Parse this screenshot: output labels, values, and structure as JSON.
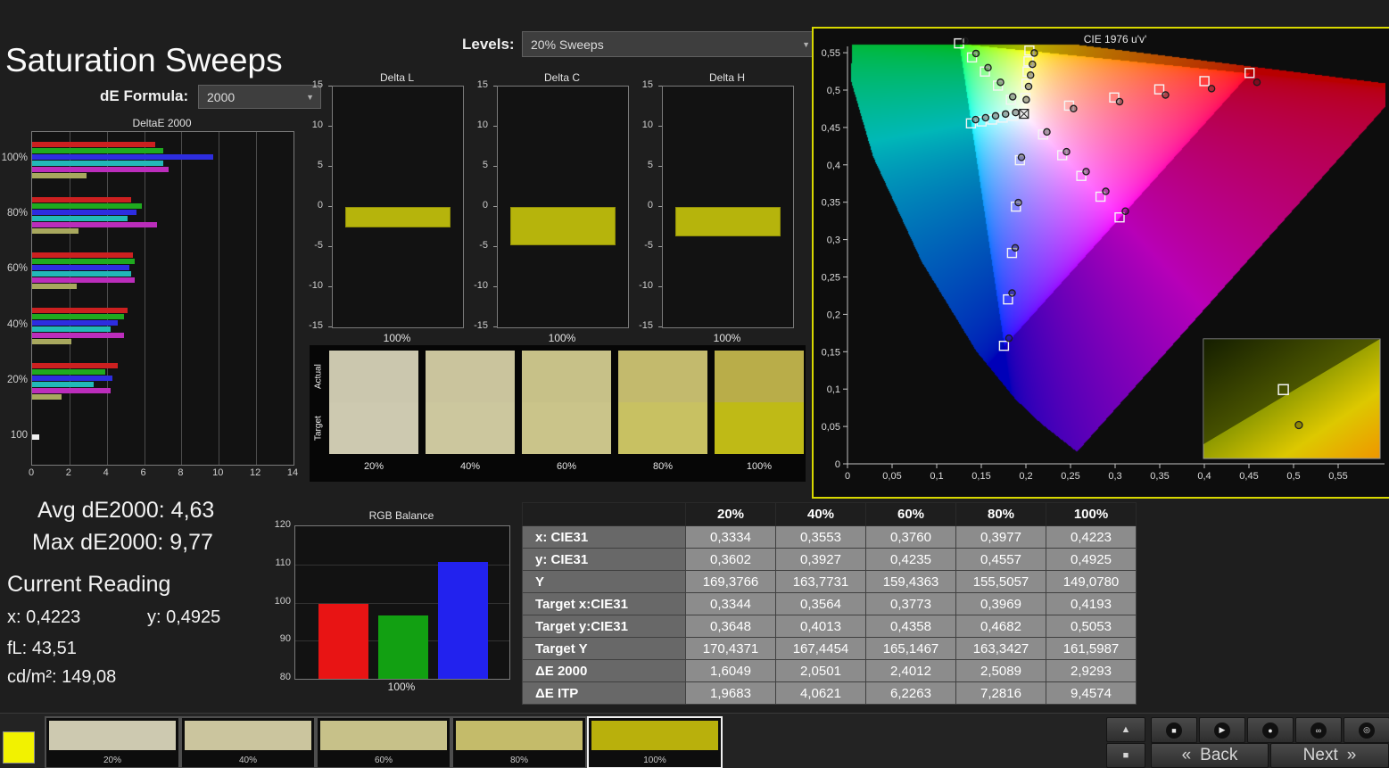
{
  "page": {
    "title": "Saturation Sweeps"
  },
  "controls": {
    "de_formula": {
      "label": "dE Formula:",
      "value": "2000"
    },
    "levels": {
      "label": "Levels:",
      "value": "20% Sweeps"
    }
  },
  "stats": {
    "avg": {
      "label": "Avg dE2000:",
      "value": "4,63"
    },
    "max": {
      "label": "Max dE2000:",
      "value": "9,77"
    },
    "current_reading": "Current Reading",
    "x": {
      "label": "x:",
      "value": "0,4223"
    },
    "y": {
      "label": "y:",
      "value": "0,4925"
    },
    "fl": {
      "label": "fL:",
      "value": "43,51"
    },
    "cdm2": {
      "label": "cd/m²:",
      "value": "149,08"
    }
  },
  "swatch_panel": {
    "row_labels": [
      "Actual",
      "Target"
    ],
    "columns": [
      {
        "label": "20%",
        "actual": "#cbc7ae",
        "target": "#cdc9b0"
      },
      {
        "label": "40%",
        "actual": "#cac49d",
        "target": "#ccc79e"
      },
      {
        "label": "60%",
        "actual": "#c7c188",
        "target": "#cac48a"
      },
      {
        "label": "80%",
        "actual": "#c3ba6d",
        "target": "#c8c162"
      },
      {
        "label": "100%",
        "actual": "#b9ad49",
        "target": "#bfba16"
      }
    ]
  },
  "table": {
    "headers": [
      "",
      "20%",
      "40%",
      "60%",
      "80%",
      "100%"
    ],
    "rows": [
      {
        "label": "x: CIE31",
        "values": [
          "0,3334",
          "0,3553",
          "0,3760",
          "0,3977",
          "0,4223"
        ]
      },
      {
        "label": "y: CIE31",
        "values": [
          "0,3602",
          "0,3927",
          "0,4235",
          "0,4557",
          "0,4925"
        ]
      },
      {
        "label": "Y",
        "values": [
          "169,3766",
          "163,7731",
          "159,4363",
          "155,5057",
          "149,0780"
        ]
      },
      {
        "label": "Target x:CIE31",
        "values": [
          "0,3344",
          "0,3564",
          "0,3773",
          "0,3969",
          "0,4193"
        ]
      },
      {
        "label": "Target y:CIE31",
        "values": [
          "0,3648",
          "0,4013",
          "0,4358",
          "0,4682",
          "0,5053"
        ]
      },
      {
        "label": "Target Y",
        "values": [
          "170,4371",
          "167,4454",
          "165,1467",
          "163,3427",
          "161,5987"
        ]
      },
      {
        "label": "ΔE 2000",
        "values": [
          "1,6049",
          "2,0501",
          "2,4012",
          "2,5089",
          "2,9293"
        ]
      },
      {
        "label": "ΔE ITP",
        "values": [
          "1,9683",
          "4,0621",
          "6,2263",
          "7,2816",
          "9,4574"
        ]
      }
    ]
  },
  "bottom_bar": {
    "patch_color": "#f2f200",
    "thumbnails": [
      {
        "label": "20%",
        "color": "#cdc9b0",
        "selected": false
      },
      {
        "label": "40%",
        "color": "#cbc59e",
        "selected": false
      },
      {
        "label": "60%",
        "color": "#c7c189",
        "selected": false
      },
      {
        "label": "80%",
        "color": "#c4bb6a",
        "selected": false
      },
      {
        "label": "100%",
        "color": "#b9b00c",
        "selected": true
      }
    ],
    "side_buttons": [
      {
        "name": "collapse",
        "glyph": "▲"
      },
      {
        "name": "stop-large",
        "glyph": "■"
      }
    ],
    "transport": [
      {
        "name": "stop",
        "glyph": "■"
      },
      {
        "name": "play",
        "glyph": "▶"
      },
      {
        "name": "record",
        "glyph": "●"
      },
      {
        "name": "loop",
        "glyph": "∞"
      },
      {
        "name": "standby",
        "glyph": "◎"
      }
    ],
    "nav": {
      "back_icon": "«",
      "back_label": "Back",
      "next_label": "Next",
      "next_icon": "»"
    }
  },
  "chart_data": {
    "deltae2000": {
      "type": "bar",
      "orientation": "horizontal",
      "title": "DeltaE 2000",
      "xlim": [
        0,
        14
      ],
      "xticks": [
        0,
        2,
        4,
        6,
        8,
        10,
        12,
        14
      ],
      "series_colors": [
        "#cc2020",
        "#1faa1f",
        "#2d2de0",
        "#22b8b8",
        "#bb2dbb",
        "#a8a85e"
      ],
      "groups": [
        {
          "label": "100%",
          "values": [
            6.6,
            7.0,
            9.7,
            7.0,
            7.3,
            2.9
          ]
        },
        {
          "label": "80%",
          "values": [
            5.3,
            5.9,
            5.6,
            5.1,
            6.7,
            2.5
          ]
        },
        {
          "label": "60%",
          "values": [
            5.4,
            5.5,
            5.2,
            5.3,
            5.5,
            2.4
          ]
        },
        {
          "label": "40%",
          "values": [
            5.1,
            4.9,
            4.6,
            4.2,
            4.9,
            2.1
          ]
        },
        {
          "label": "20%",
          "values": [
            4.6,
            3.9,
            4.3,
            3.3,
            4.2,
            1.6
          ]
        },
        {
          "label": "100",
          "values": [
            0.4
          ],
          "colors": [
            "#f0f0f0"
          ]
        }
      ]
    },
    "delta_l": {
      "type": "bar",
      "title": "Delta L",
      "ylim": [
        -15,
        15
      ],
      "yticks": [
        15,
        10,
        5,
        0,
        -5,
        -10,
        -15
      ],
      "xlabel": "100%",
      "value": -2.3,
      "color": "#b6b40c"
    },
    "delta_c": {
      "type": "bar",
      "title": "Delta C",
      "ylim": [
        -15,
        15
      ],
      "yticks": [
        15,
        10,
        5,
        0,
        -5,
        -10,
        -15
      ],
      "xlabel": "100%",
      "value": -4.6,
      "color": "#b6b40c"
    },
    "delta_h": {
      "type": "bar",
      "title": "Delta H",
      "ylim": [
        -15,
        15
      ],
      "yticks": [
        15,
        10,
        5,
        0,
        -5,
        -10,
        -15
      ],
      "xlabel": "100%",
      "value": -3.4,
      "color": "#b6b40c"
    },
    "rgb_balance": {
      "type": "bar",
      "title": "RGB Balance",
      "ylim": [
        80,
        120
      ],
      "yticks": [
        120,
        110,
        100,
        90,
        80
      ],
      "xlabel": "100%",
      "series": [
        {
          "name": "red",
          "color": "#e81414",
          "value": 99.6
        },
        {
          "name": "green",
          "color": "#12a012",
          "value": 96.6
        },
        {
          "name": "blue",
          "color": "#2222ee",
          "value": 110.6
        }
      ]
    },
    "cie": {
      "type": "scatter",
      "title": "CIE 1976 u'v'",
      "xticks": [
        {
          "v": 0,
          "label": "0"
        },
        {
          "v": 0.05,
          "label": "0,05"
        },
        {
          "v": 0.1,
          "label": "0,1"
        },
        {
          "v": 0.15,
          "label": "0,15"
        },
        {
          "v": 0.2,
          "label": "0,2"
        },
        {
          "v": 0.25,
          "label": "0,25"
        },
        {
          "v": 0.3,
          "label": "0,3"
        },
        {
          "v": 0.35,
          "label": "0,35"
        },
        {
          "v": 0.4,
          "label": "0,4"
        },
        {
          "v": 0.45,
          "label": "0,45"
        },
        {
          "v": 0.5,
          "label": "0,5"
        },
        {
          "v": 0.55,
          "label": "0,55"
        }
      ],
      "yticks": [
        {
          "v": 0,
          "label": "0"
        },
        {
          "v": 0.05,
          "label": "0,05"
        },
        {
          "v": 0.1,
          "label": "0,1"
        },
        {
          "v": 0.15,
          "label": "0,15"
        },
        {
          "v": 0.2,
          "label": "0,2"
        },
        {
          "v": 0.25,
          "label": "0,25"
        },
        {
          "v": 0.3,
          "label": "0,3"
        },
        {
          "v": 0.35,
          "label": "0,35"
        },
        {
          "v": 0.4,
          "label": "0,4"
        },
        {
          "v": 0.45,
          "label": "0,45"
        },
        {
          "v": 0.5,
          "label": "0,5"
        },
        {
          "v": 0.55,
          "label": "0,55"
        }
      ],
      "white_point": [
        0.1978,
        0.4683
      ],
      "targets": [
        [
          0.2484,
          0.4792
        ],
        [
          0.299,
          0.4901
        ],
        [
          0.3495,
          0.501
        ],
        [
          0.4001,
          0.512
        ],
        [
          0.4507,
          0.5229
        ],
        [
          0.1832,
          0.4871
        ],
        [
          0.1687,
          0.506
        ],
        [
          0.1541,
          0.5248
        ],
        [
          0.1396,
          0.5437
        ],
        [
          0.125,
          0.5625
        ],
        [
          0.1933,
          0.4062
        ],
        [
          0.1888,
          0.3441
        ],
        [
          0.1844,
          0.2821
        ],
        [
          0.1799,
          0.22
        ],
        [
          0.1754,
          0.1579
        ],
        [
          0.1859,
          0.4657
        ],
        [
          0.174,
          0.4632
        ],
        [
          0.1622,
          0.4606
        ],
        [
          0.1503,
          0.4581
        ],
        [
          0.1384,
          0.4555
        ],
        [
          0.2192,
          0.4406
        ],
        [
          0.2407,
          0.4129
        ],
        [
          0.2621,
          0.3852
        ],
        [
          0.2836,
          0.3574
        ],
        [
          0.305,
          0.3297
        ],
        [
          0.1994,
          0.4894
        ],
        [
          0.2007,
          0.5085
        ],
        [
          0.2019,
          0.5247
        ],
        [
          0.2029,
          0.5385
        ],
        [
          0.2039,
          0.5529
        ]
      ],
      "measurements": [
        [
          0.2534,
          0.4752
        ],
        [
          0.305,
          0.4845
        ],
        [
          0.3565,
          0.4935
        ],
        [
          0.4081,
          0.502
        ],
        [
          0.459,
          0.5105
        ],
        [
          0.1852,
          0.4911
        ],
        [
          0.1715,
          0.5105
        ],
        [
          0.1575,
          0.53
        ],
        [
          0.144,
          0.549
        ],
        [
          0.1315,
          0.566
        ],
        [
          0.195,
          0.41
        ],
        [
          0.1915,
          0.3495
        ],
        [
          0.188,
          0.289
        ],
        [
          0.1845,
          0.2285
        ],
        [
          0.181,
          0.168
        ],
        [
          0.1885,
          0.47
        ],
        [
          0.1772,
          0.468
        ],
        [
          0.166,
          0.4655
        ],
        [
          0.1548,
          0.463
        ],
        [
          0.1436,
          0.4605
        ],
        [
          0.2235,
          0.444
        ],
        [
          0.2455,
          0.4175
        ],
        [
          0.2675,
          0.391
        ],
        [
          0.2895,
          0.3645
        ],
        [
          0.3115,
          0.338
        ],
        [
          0.2004,
          0.4871
        ],
        [
          0.203,
          0.5048
        ],
        [
          0.2052,
          0.52
        ],
        [
          0.2073,
          0.5345
        ],
        [
          0.2094,
          0.5496
        ]
      ],
      "inset": {
        "square": [
          0.45,
          0.42
        ],
        "circle": [
          0.54,
          0.72
        ]
      }
    }
  }
}
